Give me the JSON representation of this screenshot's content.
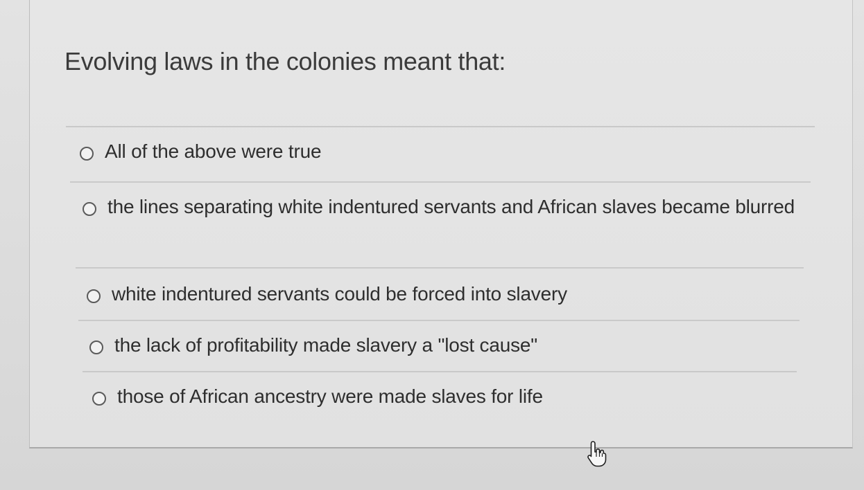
{
  "quiz": {
    "question": "Evolving laws in the colonies meant that:",
    "options": [
      {
        "label": "All of the above were true"
      },
      {
        "label": "the lines separating white indentured servants and African slaves became blurred"
      },
      {
        "label": "white indentured servants could be forced into slavery"
      },
      {
        "label": "the lack of profitability made slavery a \"lost cause\""
      },
      {
        "label": "those of African ancestry were made slaves for life"
      }
    ]
  },
  "icons": {
    "radio": "radio-unselected-icon",
    "cursor": "hand-pointer-cursor-icon"
  },
  "colors": {
    "background": "#e3e3e3",
    "text": "#2e2e2e",
    "divider": "#c9c9c9"
  }
}
